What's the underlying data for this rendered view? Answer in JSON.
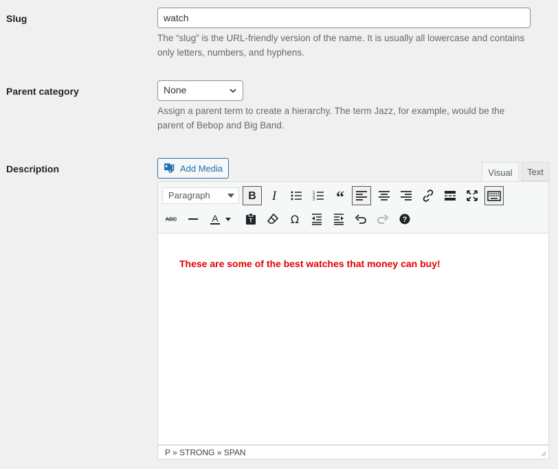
{
  "slug": {
    "label": "Slug",
    "value": "watch",
    "help": "The “slug” is the URL-friendly version of the name. It is usually all lowercase and contains only letters, numbers, and hyphens."
  },
  "parent": {
    "label": "Parent category",
    "selected": "None",
    "help": "Assign a parent term to create a hierarchy. The term Jazz, for example, would be the parent of Bebop and Big Band."
  },
  "description": {
    "label": "Description",
    "add_media": "Add Media",
    "tabs": {
      "visual": "Visual",
      "text": "Text"
    },
    "format": "Paragraph",
    "content": "These are some of the best watches that money can buy!",
    "content_color": "#e00000",
    "path": "P » STRONG » SPAN"
  },
  "toolbar_icons": [
    "bold-icon",
    "italic-icon",
    "bullet-list-icon",
    "numbered-list-icon",
    "blockquote-icon",
    "align-left-icon",
    "align-center-icon",
    "align-right-icon",
    "link-icon",
    "read-more-icon",
    "fullscreen-icon",
    "toolbar-toggle-icon",
    "strikethrough-icon",
    "horizontal-line-icon",
    "text-color-icon",
    "paste-text-icon",
    "clear-formatting-icon",
    "special-character-icon",
    "outdent-icon",
    "indent-icon",
    "undo-icon",
    "redo-icon",
    "help-icon"
  ]
}
